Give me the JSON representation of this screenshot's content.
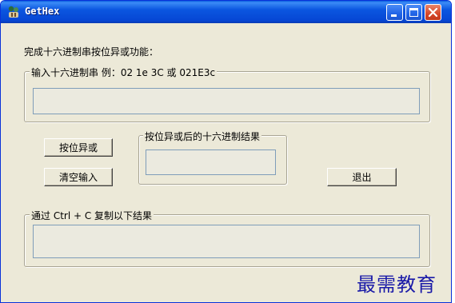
{
  "window": {
    "title": "GetHex",
    "buttons": {
      "minimize": "minimize",
      "maximize": "maximize",
      "close": "close"
    }
  },
  "main": {
    "description": "完成十六进制串按位异或功能：",
    "input_group": {
      "legend": "输入十六进制串  例：02 1e  3C 或 021E3c",
      "value": ""
    },
    "xor_button": "按位异或",
    "clear_button": "清空输入",
    "result_group": {
      "legend": "按位异或后的十六进制结果",
      "value": ""
    },
    "exit_button": "退出",
    "copy_group": {
      "legend": "通过 Ctrl + C 复制以下结果",
      "value": ""
    }
  },
  "watermark": "最需教育",
  "icons": {
    "app": "app-icon",
    "minimize": "minimize-icon",
    "maximize": "maximize-icon",
    "close": "close-icon"
  }
}
